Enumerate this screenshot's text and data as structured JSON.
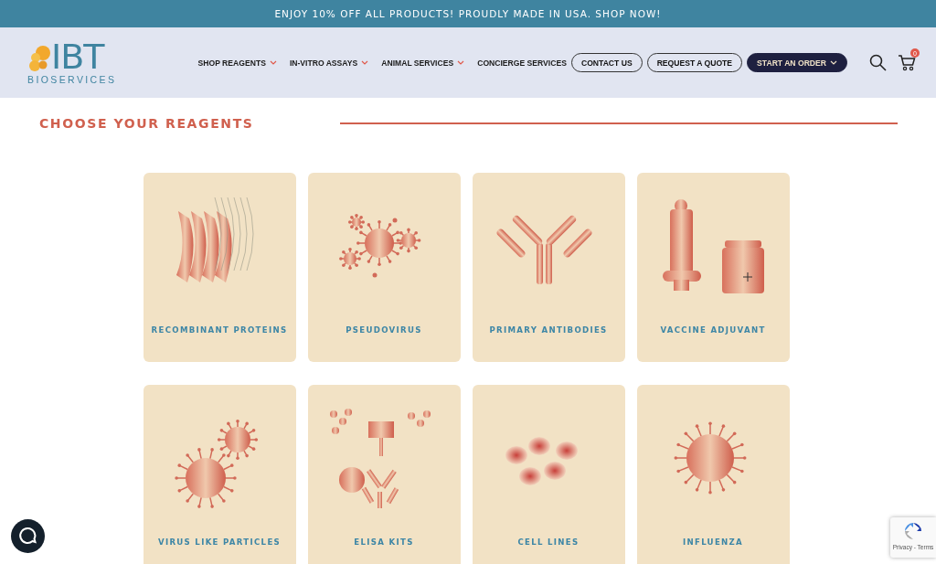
{
  "promo_bar": {
    "text": "ENJOY 10% OFF ALL PRODUCTS! PROUDLY MADE IN USA. SHOP NOW!"
  },
  "header": {
    "logo": {
      "mark": "IBT",
      "subtitle": "BIOSERVICES"
    },
    "nav": [
      {
        "label": "SHOP REAGENTS",
        "dropdown": true
      },
      {
        "label": "IN-VITRO ASSAYS",
        "dropdown": true
      },
      {
        "label": "ANIMAL SERVICES",
        "dropdown": true
      },
      {
        "label": "CONCIERGE SERVICES",
        "dropdown": false
      }
    ],
    "buttons": [
      {
        "label": "CONTACT US",
        "kind": "outline",
        "dropdown": false
      },
      {
        "label": "REQUEST A QUOTE",
        "kind": "outline",
        "dropdown": false
      },
      {
        "label": "START AN ORDER",
        "kind": "filled",
        "dropdown": true
      }
    ],
    "cart_count": "0"
  },
  "section": {
    "title": "CHOOSE YOUR REAGENTS"
  },
  "cards": [
    {
      "label": "RECOMBINANT PROTEINS",
      "kind": "protein"
    },
    {
      "label": "PSEUDOVIRUS",
      "kind": "pseudovirus"
    },
    {
      "label": "PRIMARY ANTIBODIES",
      "kind": "antibody"
    },
    {
      "label": "VACCINE ADJUVANT",
      "kind": "vaccine"
    },
    {
      "label": "VIRUS LIKE PARTICLES",
      "kind": "vlp"
    },
    {
      "label": "ELISA KITS",
      "kind": "elisa"
    },
    {
      "label": "CELL LINES",
      "kind": "cells"
    },
    {
      "label": "INFLUENZA",
      "kind": "influenza"
    }
  ],
  "recaptcha": {
    "text": "Privacy - Terms"
  }
}
